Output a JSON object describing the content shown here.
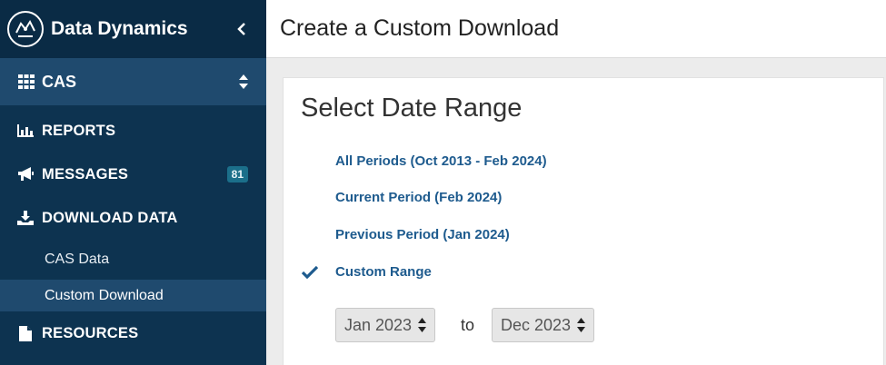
{
  "sidebar": {
    "brand": "Data Dynamics",
    "app_switcher": "CAS",
    "nav": {
      "reports": "REPORTS",
      "messages": "MESSAGES",
      "messages_count": "81",
      "download_data": "DOWNLOAD DATA",
      "resources": "RESOURCES"
    },
    "download_sub": {
      "cas_data": "CAS Data",
      "custom_download": "Custom Download"
    }
  },
  "header": {
    "title": "Create a Custom Download"
  },
  "date_range": {
    "title": "Select Date Range",
    "options": [
      "All Periods (Oct 2013 - Feb 2024)",
      "Current Period (Feb 2024)",
      "Previous Period (Jan 2024)",
      "Custom Range"
    ],
    "selected": "Custom Range",
    "from_value": "Jan 2023",
    "to_label": "to",
    "to_value": "Dec 2023"
  },
  "colors": {
    "sidebar_bg": "#0d3350",
    "sidebar_highlight": "#1f4a6e",
    "link": "#1e5b8e",
    "badge": "#1b6f8a"
  }
}
